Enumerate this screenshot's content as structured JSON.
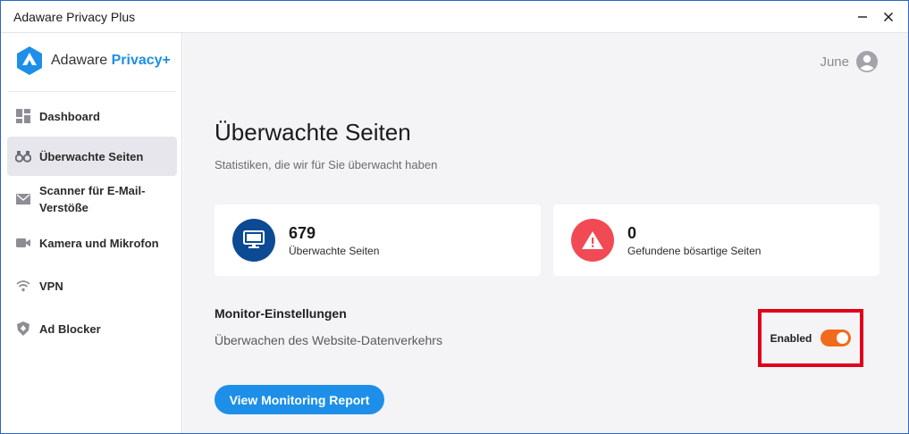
{
  "window": {
    "title": "Adaware Privacy Plus",
    "minimize_symbol": "—",
    "close_symbol": "✕"
  },
  "logo": {
    "name": "Adaware",
    "accent": "Privacy+",
    "icon": "shield-logo-icon"
  },
  "sidebar": {
    "items": [
      {
        "label": "Dashboard",
        "icon": "dashboard-grid-icon",
        "active": false
      },
      {
        "label": "Überwachte Seiten",
        "icon": "binoculars-icon",
        "active": true
      },
      {
        "label": "Scanner für E-Mail-Verstöße",
        "icon": "envelope-icon",
        "active": false
      },
      {
        "label": "Kamera und Mikrofon",
        "icon": "camera-icon",
        "active": false
      },
      {
        "label": "VPN",
        "icon": "wifi-icon",
        "active": false
      },
      {
        "label": "Ad Blocker",
        "icon": "ad-blocker-shield-icon",
        "active": false
      }
    ]
  },
  "user": {
    "name": "June",
    "icon": "user-avatar-icon"
  },
  "page": {
    "title": "Überwachte Seiten",
    "subtitle": "Statistiken, die wir für Sie überwacht haben"
  },
  "stats": [
    {
      "value": "679",
      "label": "Überwachte Seiten",
      "icon": "monitor-icon",
      "color": "#0c4a94"
    },
    {
      "value": "0",
      "label": "Gefundene bösartige Seiten",
      "icon": "warning-triangle-icon",
      "color": "#f14a54"
    }
  ],
  "settings": {
    "title": "Monitor-Einstellungen",
    "description": "Überwachen des Website-Datenverkehrs",
    "toggle_label": "Enabled",
    "toggle_on": true
  },
  "report_button": {
    "label": "View Monitoring Report"
  },
  "colors": {
    "accent": "#1e8fe8",
    "toggle_on": "#f26a1b",
    "highlight_box": "#e0001a",
    "sidebar_active": "#e6e6ec",
    "main_bg": "#f4f4f6"
  }
}
